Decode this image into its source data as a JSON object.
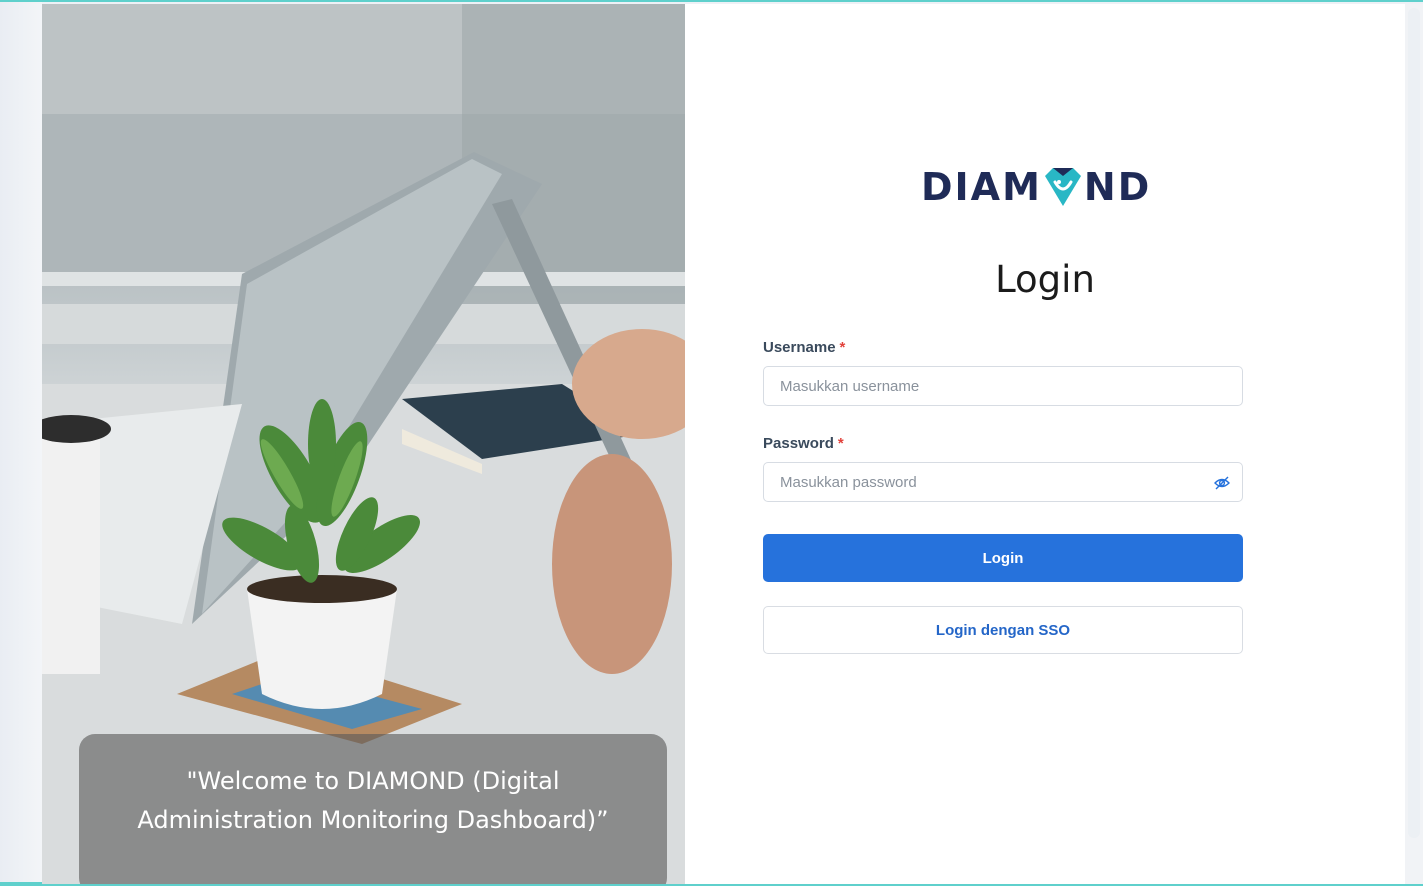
{
  "brand": {
    "logo_prefix": "DIAM",
    "logo_suffix": "ND",
    "colors": {
      "navy": "#1f2b57",
      "teal": "#29b7c5",
      "primary": "#2672dc"
    }
  },
  "hero": {
    "caption_line1": "\"Welcome to DIAMOND (Digital",
    "caption_line2": "Administration Monitoring Dashboard)”"
  },
  "login": {
    "title": "Login",
    "username_label": "Username",
    "username_placeholder": "Masukkan username",
    "password_label": "Password",
    "password_placeholder": "Masukkan password",
    "required_mark": "*",
    "submit_label": "Login",
    "sso_label": "Login dengan SSO",
    "password_toggle_icon": "eye-off-icon"
  }
}
